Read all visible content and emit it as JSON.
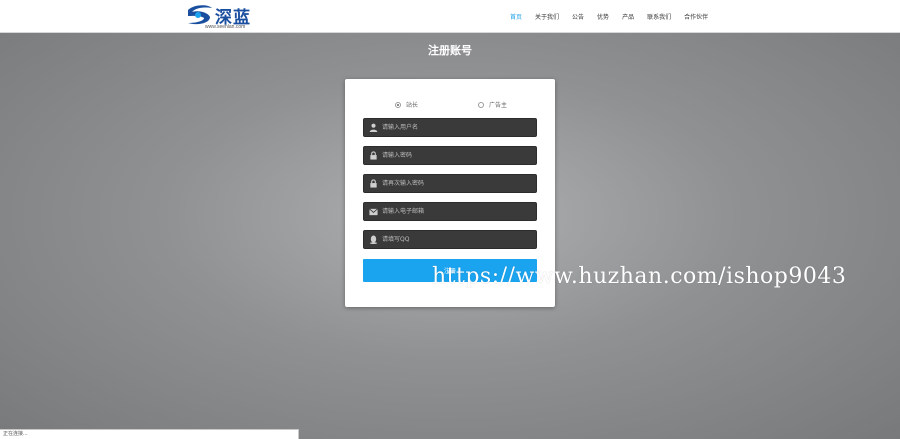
{
  "header": {
    "logo_text": "深蓝",
    "logo_url": "www.seenlan.com",
    "nav": [
      {
        "label": "首页",
        "active": true
      },
      {
        "label": "关于我们",
        "active": false
      },
      {
        "label": "公告",
        "active": false
      },
      {
        "label": "优势",
        "active": false
      },
      {
        "label": "产品",
        "active": false
      },
      {
        "label": "联系我们",
        "active": false
      },
      {
        "label": "合作伙伴",
        "active": false
      }
    ]
  },
  "page": {
    "title": "注册账号"
  },
  "form": {
    "roles": [
      {
        "label": "站长",
        "checked": true
      },
      {
        "label": "广告主",
        "checked": false
      }
    ],
    "fields": [
      {
        "placeholder": "请输入用户名",
        "icon": "user-icon"
      },
      {
        "placeholder": "请输入密码",
        "icon": "lock-icon"
      },
      {
        "placeholder": "请再次输入密码",
        "icon": "lock-icon"
      },
      {
        "placeholder": "请输入电子邮箱",
        "icon": "envelope-icon"
      },
      {
        "placeholder": "请填写QQ",
        "icon": "qq-icon"
      }
    ],
    "submit_label": "注册"
  },
  "watermark": "https://www.huzhan.com/ishop9043",
  "status_bar": "正在连接...",
  "colors": {
    "accent": "#1aa3ee",
    "field_bg": "#3a3a3a",
    "logo_blue": "#1a4fa0"
  }
}
